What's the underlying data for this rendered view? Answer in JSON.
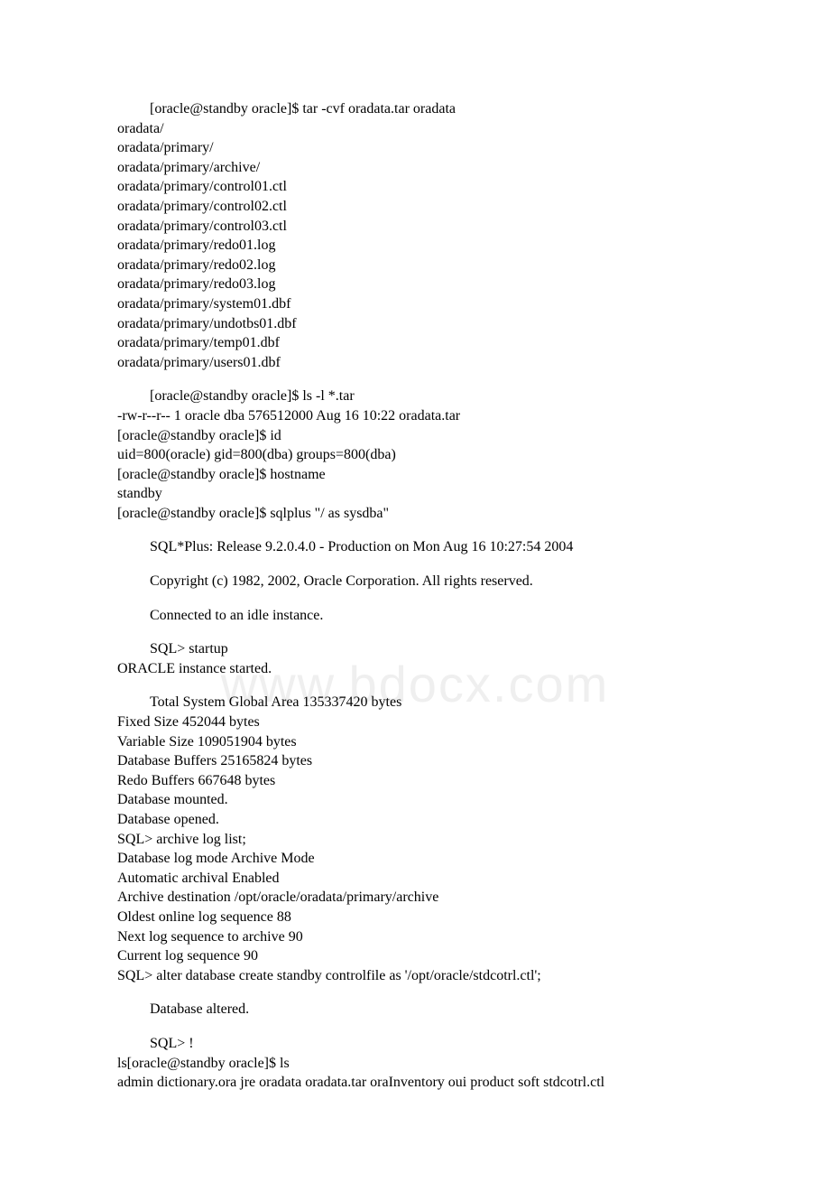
{
  "watermark": "www.bdocx.com",
  "blocks": [
    {
      "indent": true,
      "gap": false,
      "text": "[oracle@standby oracle]$ tar -cvf oradata.tar oradata"
    },
    {
      "indent": false,
      "gap": false,
      "text": "oradata/"
    },
    {
      "indent": false,
      "gap": false,
      "text": "oradata/primary/"
    },
    {
      "indent": false,
      "gap": false,
      "text": "oradata/primary/archive/"
    },
    {
      "indent": false,
      "gap": false,
      "text": "oradata/primary/control01.ctl"
    },
    {
      "indent": false,
      "gap": false,
      "text": "oradata/primary/control02.ctl"
    },
    {
      "indent": false,
      "gap": false,
      "text": "oradata/primary/control03.ctl"
    },
    {
      "indent": false,
      "gap": false,
      "text": "oradata/primary/redo01.log"
    },
    {
      "indent": false,
      "gap": false,
      "text": "oradata/primary/redo02.log"
    },
    {
      "indent": false,
      "gap": false,
      "text": "oradata/primary/redo03.log"
    },
    {
      "indent": false,
      "gap": false,
      "text": "oradata/primary/system01.dbf"
    },
    {
      "indent": false,
      "gap": false,
      "text": "oradata/primary/undotbs01.dbf"
    },
    {
      "indent": false,
      "gap": false,
      "text": "oradata/primary/temp01.dbf"
    },
    {
      "indent": false,
      "gap": false,
      "text": "oradata/primary/users01.dbf"
    },
    {
      "indent": true,
      "gap": true,
      "text": "[oracle@standby oracle]$ ls -l *.tar"
    },
    {
      "indent": false,
      "gap": false,
      "text": "-rw-r--r-- 1 oracle dba 576512000 Aug 16 10:22 oradata.tar"
    },
    {
      "indent": false,
      "gap": false,
      "text": "[oracle@standby oracle]$ id"
    },
    {
      "indent": false,
      "gap": false,
      "text": "uid=800(oracle) gid=800(dba) groups=800(dba)"
    },
    {
      "indent": false,
      "gap": false,
      "text": "[oracle@standby oracle]$ hostname"
    },
    {
      "indent": false,
      "gap": false,
      "text": "standby"
    },
    {
      "indent": false,
      "gap": false,
      "text": "[oracle@standby oracle]$ sqlplus \"/ as sysdba\""
    },
    {
      "indent": true,
      "gap": true,
      "text": "SQL*Plus: Release 9.2.0.4.0 - Production on Mon Aug 16 10:27:54 2004"
    },
    {
      "indent": true,
      "gap": true,
      "text": "Copyright (c) 1982, 2002, Oracle Corporation. All rights reserved."
    },
    {
      "indent": true,
      "gap": true,
      "text": "Connected to an idle instance."
    },
    {
      "indent": true,
      "gap": true,
      "text": "SQL> startup"
    },
    {
      "indent": false,
      "gap": false,
      "text": "ORACLE instance started."
    },
    {
      "indent": true,
      "gap": true,
      "text": "Total System Global Area 135337420 bytes"
    },
    {
      "indent": false,
      "gap": false,
      "text": "Fixed Size 452044 bytes"
    },
    {
      "indent": false,
      "gap": false,
      "text": "Variable Size 109051904 bytes"
    },
    {
      "indent": false,
      "gap": false,
      "text": "Database Buffers 25165824 bytes"
    },
    {
      "indent": false,
      "gap": false,
      "text": "Redo Buffers 667648 bytes"
    },
    {
      "indent": false,
      "gap": false,
      "text": "Database mounted."
    },
    {
      "indent": false,
      "gap": false,
      "text": "Database opened."
    },
    {
      "indent": false,
      "gap": false,
      "text": "SQL> archive log list;"
    },
    {
      "indent": false,
      "gap": false,
      "text": "Database log mode Archive Mode"
    },
    {
      "indent": false,
      "gap": false,
      "text": "Automatic archival Enabled"
    },
    {
      "indent": false,
      "gap": false,
      "text": "Archive destination /opt/oracle/oradata/primary/archive"
    },
    {
      "indent": false,
      "gap": false,
      "text": "Oldest online log sequence 88"
    },
    {
      "indent": false,
      "gap": false,
      "text": "Next log sequence to archive 90"
    },
    {
      "indent": false,
      "gap": false,
      "text": "Current log sequence 90"
    },
    {
      "indent": false,
      "gap": false,
      "text": "SQL> alter database create standby controlfile as '/opt/oracle/stdcotrl.ctl';"
    },
    {
      "indent": true,
      "gap": true,
      "text": "Database altered."
    },
    {
      "indent": true,
      "gap": true,
      "text": "SQL> !"
    },
    {
      "indent": false,
      "gap": false,
      "text": "ls[oracle@standby oracle]$ ls"
    },
    {
      "indent": false,
      "gap": false,
      "text": "admin dictionary.ora jre oradata oradata.tar oraInventory oui product soft stdcotrl.ctl"
    }
  ]
}
